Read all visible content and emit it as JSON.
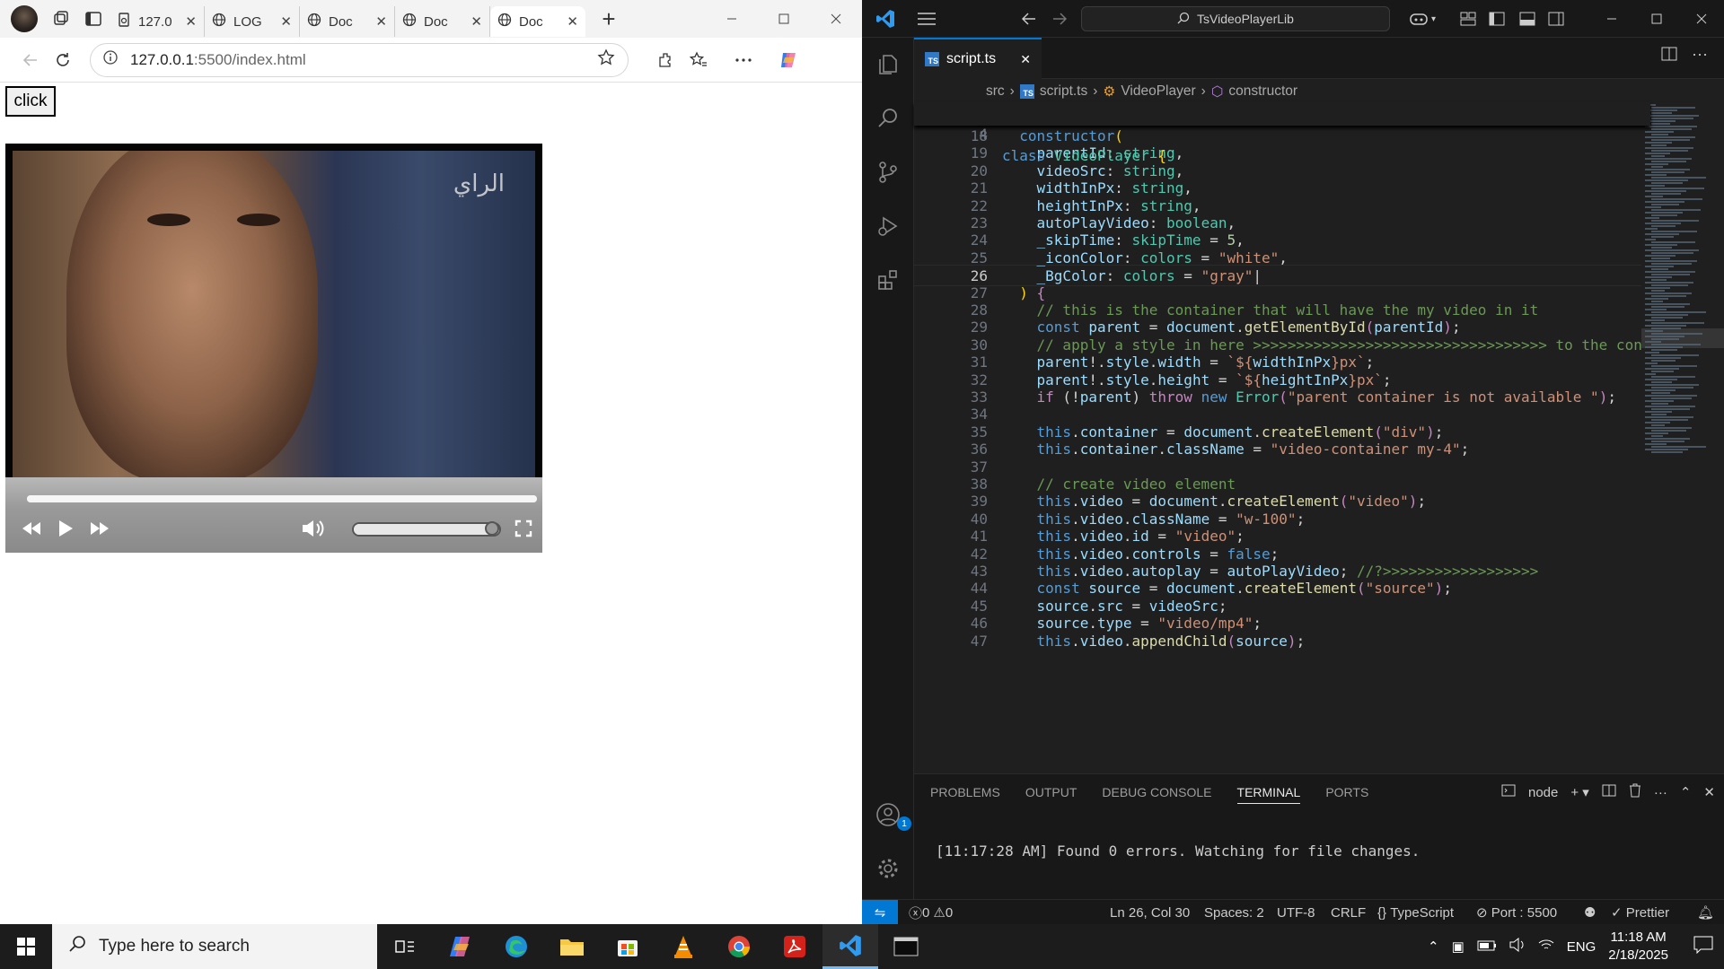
{
  "browser": {
    "tabs": [
      {
        "label": "127.0",
        "icon": "page-icon"
      },
      {
        "label": "LOG",
        "icon": "globe-icon"
      },
      {
        "label": "Doc",
        "icon": "globe-icon"
      },
      {
        "label": "Doc",
        "icon": "globe-icon"
      },
      {
        "label": "Doc",
        "icon": "globe-icon"
      }
    ],
    "new_tab_symbol": "+",
    "close_symbol": "✕",
    "address_host": "127.0.0.1",
    "address_rest": ":5500/index.html",
    "page": {
      "button_label": "click",
      "watermark": "الراي",
      "video_progress": 1.0,
      "volume_level": 1.0
    }
  },
  "vscode": {
    "search_text": "TsVideoPlayerLib",
    "tab": {
      "label": "script.ts",
      "close": "✕"
    },
    "breadcrumb": {
      "folder": "src",
      "file": "script.ts",
      "class": "VideoPlayer",
      "member": "constructor"
    },
    "sticky": {
      "line": "4",
      "code": [
        [
          "class ",
          "k"
        ],
        [
          "VideoPlayer ",
          "t"
        ],
        [
          "{",
          "y"
        ]
      ]
    },
    "current_line": "26",
    "code_lines": [
      {
        "n": "18",
        "tokens": [
          [
            "  ",
            ""
          ],
          [
            "constructor",
            "k"
          ],
          [
            "(",
            "y"
          ]
        ]
      },
      {
        "n": "19",
        "tokens": [
          [
            "    ",
            ""
          ],
          [
            "parentId",
            "v"
          ],
          [
            ": ",
            ""
          ],
          [
            "string",
            "t"
          ],
          [
            ",",
            ""
          ]
        ]
      },
      {
        "n": "20",
        "tokens": [
          [
            "    ",
            ""
          ],
          [
            "videoSrc",
            "v"
          ],
          [
            ": ",
            ""
          ],
          [
            "string",
            "t"
          ],
          [
            ",",
            ""
          ]
        ]
      },
      {
        "n": "21",
        "tokens": [
          [
            "    ",
            ""
          ],
          [
            "widthInPx",
            "v"
          ],
          [
            ": ",
            ""
          ],
          [
            "string",
            "t"
          ],
          [
            ",",
            ""
          ]
        ]
      },
      {
        "n": "22",
        "tokens": [
          [
            "    ",
            ""
          ],
          [
            "heightInPx",
            "v"
          ],
          [
            ": ",
            ""
          ],
          [
            "string",
            "t"
          ],
          [
            ",",
            ""
          ]
        ]
      },
      {
        "n": "23",
        "tokens": [
          [
            "    ",
            ""
          ],
          [
            "autoPlayVideo",
            "v"
          ],
          [
            ": ",
            ""
          ],
          [
            "boolean",
            "t"
          ],
          [
            ",",
            ""
          ]
        ]
      },
      {
        "n": "24",
        "tokens": [
          [
            "    ",
            ""
          ],
          [
            "_skipTime",
            "v"
          ],
          [
            ": ",
            ""
          ],
          [
            "skipTime",
            "t"
          ],
          [
            " = ",
            ""
          ],
          [
            "5",
            "n"
          ],
          [
            ",",
            ""
          ]
        ]
      },
      {
        "n": "25",
        "tokens": [
          [
            "    ",
            ""
          ],
          [
            "_iconColor",
            "v"
          ],
          [
            ": ",
            ""
          ],
          [
            "colors",
            "t"
          ],
          [
            " = ",
            ""
          ],
          [
            "\"white\"",
            "s"
          ],
          [
            ",",
            ""
          ]
        ]
      },
      {
        "n": "26",
        "tokens": [
          [
            "    ",
            ""
          ],
          [
            "_BgColor",
            "v"
          ],
          [
            ": ",
            ""
          ],
          [
            "colors",
            "t"
          ],
          [
            " = ",
            ""
          ],
          [
            "\"gray\"",
            "s"
          ],
          [
            "|",
            ""
          ]
        ]
      },
      {
        "n": "27",
        "tokens": [
          [
            "  ",
            ""
          ],
          [
            ")",
            "y"
          ],
          [
            " {",
            "p"
          ]
        ]
      },
      {
        "n": "28",
        "tokens": [
          [
            "    ",
            ""
          ],
          [
            "// this is the container that will have the my video in it",
            "c"
          ]
        ]
      },
      {
        "n": "29",
        "tokens": [
          [
            "    ",
            ""
          ],
          [
            "const ",
            "k"
          ],
          [
            "parent",
            "v"
          ],
          [
            " = ",
            ""
          ],
          [
            "document",
            "v"
          ],
          [
            ".",
            ""
          ],
          [
            "getElementById",
            "f"
          ],
          [
            "(",
            "p"
          ],
          [
            "parentId",
            "v"
          ],
          [
            ")",
            "p"
          ],
          [
            ";",
            ""
          ]
        ]
      },
      {
        "n": "30",
        "tokens": [
          [
            "    ",
            ""
          ],
          [
            "// apply a style in here >>>>>>>>>>>>>>>>>>>>>>>>>>>>>>>>>> to the con",
            "c"
          ]
        ]
      },
      {
        "n": "31",
        "tokens": [
          [
            "    ",
            ""
          ],
          [
            "parent",
            "v"
          ],
          [
            "!.",
            ""
          ],
          [
            "style",
            "v"
          ],
          [
            ".",
            ""
          ],
          [
            "width",
            "v"
          ],
          [
            " = ",
            ""
          ],
          [
            "`${",
            "s"
          ],
          [
            "widthInPx",
            "v"
          ],
          [
            "}px`",
            "s"
          ],
          [
            ";",
            ""
          ]
        ]
      },
      {
        "n": "32",
        "tokens": [
          [
            "    ",
            ""
          ],
          [
            "parent",
            "v"
          ],
          [
            "!.",
            ""
          ],
          [
            "style",
            "v"
          ],
          [
            ".",
            ""
          ],
          [
            "height",
            "v"
          ],
          [
            " = ",
            ""
          ],
          [
            "`${",
            "s"
          ],
          [
            "heightInPx",
            "v"
          ],
          [
            "}px`",
            "s"
          ],
          [
            ";",
            ""
          ]
        ]
      },
      {
        "n": "33",
        "tokens": [
          [
            "    ",
            ""
          ],
          [
            "if",
            "p"
          ],
          [
            " (!",
            ""
          ],
          [
            "parent",
            "v"
          ],
          [
            ") ",
            ""
          ],
          [
            "throw ",
            "p"
          ],
          [
            "new ",
            "k"
          ],
          [
            "Error",
            "t"
          ],
          [
            "(",
            "p"
          ],
          [
            "\"parent container is not available \"",
            "s"
          ],
          [
            ")",
            "p"
          ],
          [
            ";",
            ""
          ]
        ]
      },
      {
        "n": "34",
        "tokens": [
          [
            "",
            ""
          ]
        ]
      },
      {
        "n": "35",
        "tokens": [
          [
            "    ",
            ""
          ],
          [
            "this",
            "k"
          ],
          [
            ".",
            ""
          ],
          [
            "container",
            "v"
          ],
          [
            " = ",
            ""
          ],
          [
            "document",
            "v"
          ],
          [
            ".",
            ""
          ],
          [
            "createElement",
            "f"
          ],
          [
            "(",
            "p"
          ],
          [
            "\"div\"",
            "s"
          ],
          [
            ")",
            "p"
          ],
          [
            ";",
            ""
          ]
        ]
      },
      {
        "n": "36",
        "tokens": [
          [
            "    ",
            ""
          ],
          [
            "this",
            "k"
          ],
          [
            ".",
            ""
          ],
          [
            "container",
            "v"
          ],
          [
            ".",
            ""
          ],
          [
            "className",
            "v"
          ],
          [
            " = ",
            ""
          ],
          [
            "\"video-container my-4\"",
            "s"
          ],
          [
            ";",
            ""
          ]
        ]
      },
      {
        "n": "37",
        "tokens": [
          [
            "",
            ""
          ]
        ]
      },
      {
        "n": "38",
        "tokens": [
          [
            "    ",
            ""
          ],
          [
            "// create video element",
            "c"
          ]
        ]
      },
      {
        "n": "39",
        "tokens": [
          [
            "    ",
            ""
          ],
          [
            "this",
            "k"
          ],
          [
            ".",
            ""
          ],
          [
            "video",
            "v"
          ],
          [
            " = ",
            ""
          ],
          [
            "document",
            "v"
          ],
          [
            ".",
            ""
          ],
          [
            "createElement",
            "f"
          ],
          [
            "(",
            "p"
          ],
          [
            "\"video\"",
            "s"
          ],
          [
            ")",
            "p"
          ],
          [
            ";",
            ""
          ]
        ]
      },
      {
        "n": "40",
        "tokens": [
          [
            "    ",
            ""
          ],
          [
            "this",
            "k"
          ],
          [
            ".",
            ""
          ],
          [
            "video",
            "v"
          ],
          [
            ".",
            ""
          ],
          [
            "className",
            "v"
          ],
          [
            " = ",
            ""
          ],
          [
            "\"w-100\"",
            "s"
          ],
          [
            ";",
            ""
          ]
        ]
      },
      {
        "n": "41",
        "tokens": [
          [
            "    ",
            ""
          ],
          [
            "this",
            "k"
          ],
          [
            ".",
            ""
          ],
          [
            "video",
            "v"
          ],
          [
            ".",
            ""
          ],
          [
            "id",
            "v"
          ],
          [
            " = ",
            ""
          ],
          [
            "\"video\"",
            "s"
          ],
          [
            ";",
            ""
          ]
        ]
      },
      {
        "n": "42",
        "tokens": [
          [
            "    ",
            ""
          ],
          [
            "this",
            "k"
          ],
          [
            ".",
            ""
          ],
          [
            "video",
            "v"
          ],
          [
            ".",
            ""
          ],
          [
            "controls",
            "v"
          ],
          [
            " = ",
            ""
          ],
          [
            "false",
            "k"
          ],
          [
            ";",
            ""
          ]
        ]
      },
      {
        "n": "43",
        "tokens": [
          [
            "    ",
            ""
          ],
          [
            "this",
            "k"
          ],
          [
            ".",
            ""
          ],
          [
            "video",
            "v"
          ],
          [
            ".",
            ""
          ],
          [
            "autoplay",
            "v"
          ],
          [
            " = ",
            ""
          ],
          [
            "autoPlayVideo",
            "v"
          ],
          [
            "; ",
            ""
          ],
          [
            "//?>>>>>>>>>>>>>>>>>>",
            "c"
          ]
        ]
      },
      {
        "n": "44",
        "tokens": [
          [
            "    ",
            ""
          ],
          [
            "const ",
            "k"
          ],
          [
            "source",
            "v"
          ],
          [
            " = ",
            ""
          ],
          [
            "document",
            "v"
          ],
          [
            ".",
            ""
          ],
          [
            "createElement",
            "f"
          ],
          [
            "(",
            "p"
          ],
          [
            "\"source\"",
            "s"
          ],
          [
            ")",
            "p"
          ],
          [
            ";",
            ""
          ]
        ]
      },
      {
        "n": "45",
        "tokens": [
          [
            "    ",
            ""
          ],
          [
            "source",
            "v"
          ],
          [
            ".",
            ""
          ],
          [
            "src",
            "v"
          ],
          [
            " = ",
            ""
          ],
          [
            "videoSrc",
            "v"
          ],
          [
            ";",
            ""
          ]
        ]
      },
      {
        "n": "46",
        "tokens": [
          [
            "    ",
            ""
          ],
          [
            "source",
            "v"
          ],
          [
            ".",
            ""
          ],
          [
            "type",
            "v"
          ],
          [
            " = ",
            ""
          ],
          [
            "\"video/mp4\"",
            "s"
          ],
          [
            ";",
            ""
          ]
        ]
      },
      {
        "n": "47",
        "tokens": [
          [
            "    ",
            ""
          ],
          [
            "this",
            "k"
          ],
          [
            ".",
            ""
          ],
          [
            "video",
            "v"
          ],
          [
            ".",
            ""
          ],
          [
            "appendChild",
            "f"
          ],
          [
            "(",
            "p"
          ],
          [
            "source",
            "v"
          ],
          [
            ")",
            "p"
          ],
          [
            ";",
            ""
          ]
        ]
      }
    ],
    "panel": {
      "tabs": [
        "PROBLEMS",
        "OUTPUT",
        "DEBUG CONSOLE",
        "TERMINAL",
        "PORTS"
      ],
      "active_tab": "TERMINAL",
      "terminal_name": "node",
      "terminal_text": "[11:17:28 AM] Found 0 errors. Watching for file changes."
    },
    "status": {
      "errors": "0",
      "warnings": "0",
      "position": "Ln 26, Col 30",
      "spaces": "Spaces: 2",
      "encoding": "UTF-8",
      "eol": "CRLF",
      "language": "TypeScript",
      "port": "Port : 5500",
      "formatter": "Prettier"
    },
    "colors": {
      "accent": "#0078d4",
      "bg": "#1f1f1f"
    }
  },
  "taskbar": {
    "search_placeholder": "Type here to search",
    "tray_lang": "ENG",
    "time": "11:18 AM",
    "date": "2/18/2025"
  }
}
